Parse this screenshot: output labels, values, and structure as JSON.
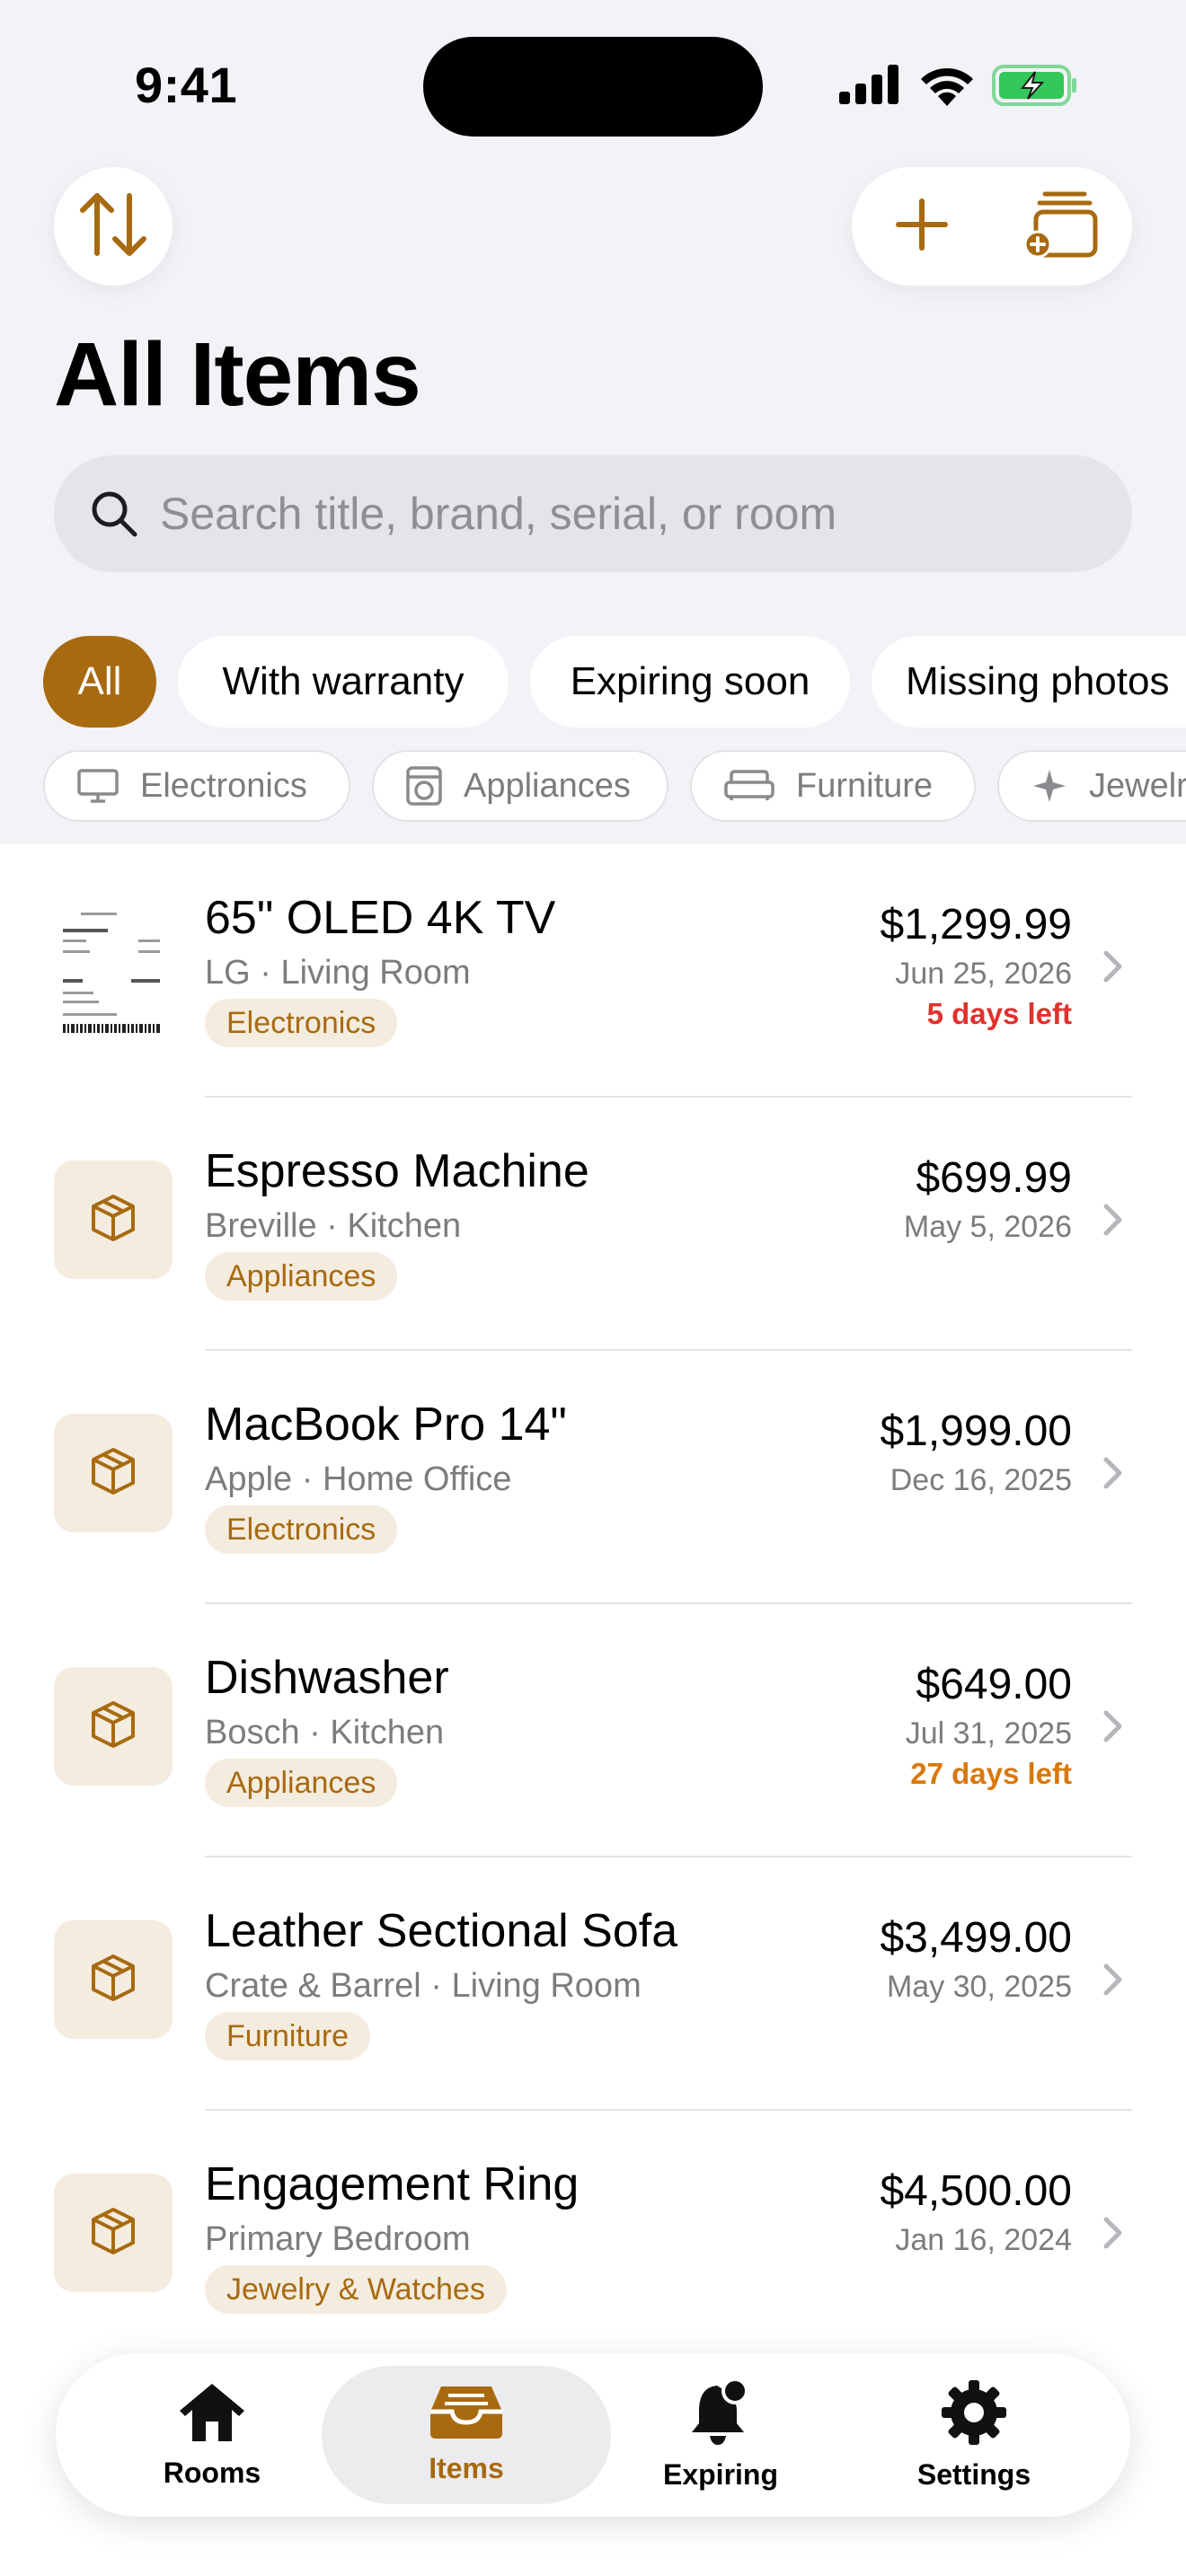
{
  "status_bar": {
    "time": "9:41"
  },
  "header": {
    "title": "All Items",
    "sort_icon": "arrow-up-down-icon",
    "add_icon": "plus-icon",
    "add_multiple_icon": "stack-add-icon"
  },
  "search": {
    "placeholder": "Search title, brand, serial, or room",
    "value": ""
  },
  "filters": [
    {
      "label": "All",
      "active": true
    },
    {
      "label": "With warranty",
      "active": false
    },
    {
      "label": "Expiring soon",
      "active": false
    },
    {
      "label": "Missing photos",
      "active": false
    }
  ],
  "categories": [
    {
      "label": "Electronics",
      "icon": "tv-icon"
    },
    {
      "label": "Appliances",
      "icon": "washer-icon"
    },
    {
      "label": "Furniture",
      "icon": "sofa-icon"
    },
    {
      "label": "Jewelry",
      "icon": "sparkle-icon"
    }
  ],
  "items": [
    {
      "name": "65\" OLED 4K TV",
      "subtitle": "LG · Living Room",
      "category": "Electronics",
      "price": "$1,299.99",
      "date": "Jun 25, 2026",
      "warranty_left": "5 days left",
      "warranty_color": "#e0312d",
      "thumbnail": "receipt"
    },
    {
      "name": "Espresso Machine",
      "subtitle": "Breville · Kitchen",
      "category": "Appliances",
      "price": "$699.99",
      "date": "May 5, 2026",
      "warranty_left": "",
      "thumbnail": "box-icon"
    },
    {
      "name": "MacBook Pro 14\"",
      "subtitle": "Apple · Home Office",
      "category": "Electronics",
      "price": "$1,999.00",
      "date": "Dec 16, 2025",
      "warranty_left": "",
      "thumbnail": "box-icon"
    },
    {
      "name": "Dishwasher",
      "subtitle": "Bosch · Kitchen",
      "category": "Appliances",
      "price": "$649.00",
      "date": "Jul 31, 2025",
      "warranty_left": "27 days left",
      "warranty_color": "#d9780c",
      "thumbnail": "box-icon"
    },
    {
      "name": "Leather Sectional Sofa",
      "subtitle": "Crate & Barrel · Living Room",
      "category": "Furniture",
      "price": "$3,499.00",
      "date": "May 30, 2025",
      "warranty_left": "",
      "thumbnail": "box-icon"
    },
    {
      "name": "Engagement Ring",
      "subtitle": "Primary Bedroom",
      "category": "Jewelry & Watches",
      "price": "$4,500.00",
      "date": "Jan 16, 2024",
      "warranty_left": "",
      "thumbnail": "box-icon"
    }
  ],
  "tabs": [
    {
      "label": "Rooms",
      "icon": "house-icon",
      "active": false
    },
    {
      "label": "Items",
      "icon": "tray-icon",
      "active": true
    },
    {
      "label": "Expiring",
      "icon": "bell-badge-icon",
      "active": false
    },
    {
      "label": "Settings",
      "icon": "gear-icon",
      "active": false
    }
  ],
  "colors": {
    "accent": "#a86a10",
    "accent_bg": "#f4ecdf",
    "urgent": "#e0312d",
    "warning": "#d9780c"
  }
}
